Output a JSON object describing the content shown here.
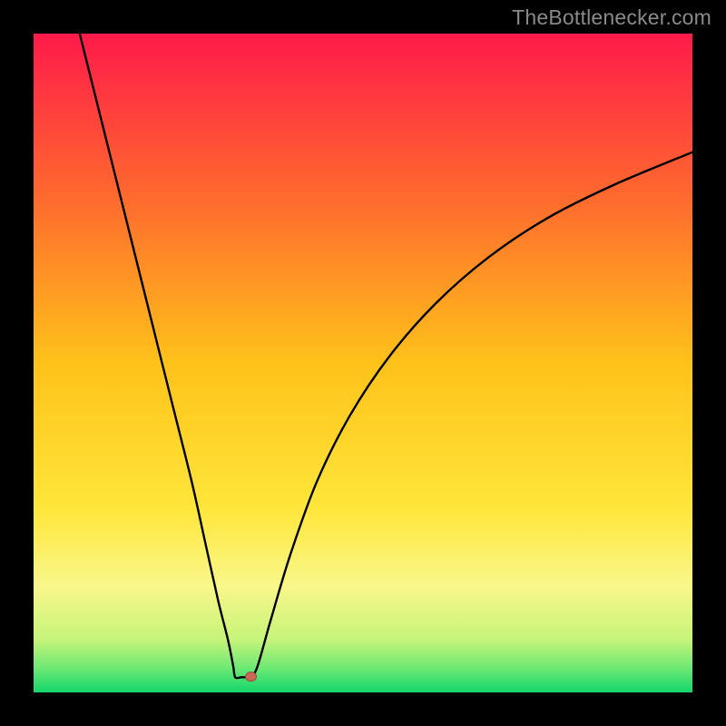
{
  "watermark": "TheBottlenecker.com",
  "colors": {
    "black": "#000000",
    "curve": "#000000",
    "marker_fill": "#cc6655",
    "marker_stroke": "#9a4a3f"
  },
  "chart_data": {
    "type": "line",
    "title": "",
    "xlabel": "",
    "ylabel": "",
    "xlim": [
      0,
      100
    ],
    "ylim": [
      0,
      100
    ],
    "grid": false,
    "legend": false,
    "background_gradient_stops": [
      {
        "offset": 0,
        "color": "#ff1a4a"
      },
      {
        "offset": 0.25,
        "color": "#ff6a2e"
      },
      {
        "offset": 0.5,
        "color": "#ffc21a"
      },
      {
        "offset": 0.72,
        "color": "#ffe63a"
      },
      {
        "offset": 0.84,
        "color": "#f8f78a"
      },
      {
        "offset": 0.92,
        "color": "#c6f47a"
      },
      {
        "offset": 0.965,
        "color": "#69e874"
      },
      {
        "offset": 1.0,
        "color": "#12d66a"
      }
    ],
    "series": [
      {
        "name": "bottleneck-curve",
        "points": [
          {
            "x": 7.0,
            "y": 100.0
          },
          {
            "x": 9.0,
            "y": 92.0
          },
          {
            "x": 12.0,
            "y": 80.0
          },
          {
            "x": 15.0,
            "y": 68.0
          },
          {
            "x": 18.0,
            "y": 56.0
          },
          {
            "x": 21.0,
            "y": 44.0
          },
          {
            "x": 24.0,
            "y": 32.0
          },
          {
            "x": 26.0,
            "y": 23.0
          },
          {
            "x": 28.0,
            "y": 14.0
          },
          {
            "x": 29.5,
            "y": 8.0
          },
          {
            "x": 30.3,
            "y": 4.0
          },
          {
            "x": 30.6,
            "y": 2.3
          },
          {
            "x": 31.5,
            "y": 2.3
          },
          {
            "x": 32.2,
            "y": 2.3
          },
          {
            "x": 33.0,
            "y": 2.4
          },
          {
            "x": 34.0,
            "y": 4.0
          },
          {
            "x": 36.0,
            "y": 11.0
          },
          {
            "x": 39.0,
            "y": 21.0
          },
          {
            "x": 43.0,
            "y": 32.0
          },
          {
            "x": 48.0,
            "y": 42.0
          },
          {
            "x": 54.0,
            "y": 51.0
          },
          {
            "x": 61.0,
            "y": 59.0
          },
          {
            "x": 69.0,
            "y": 66.0
          },
          {
            "x": 78.0,
            "y": 72.0
          },
          {
            "x": 88.0,
            "y": 77.0
          },
          {
            "x": 100.0,
            "y": 82.0
          }
        ]
      }
    ],
    "marker": {
      "x": 33.0,
      "y": 2.4,
      "rx": 6,
      "ry": 5
    }
  }
}
